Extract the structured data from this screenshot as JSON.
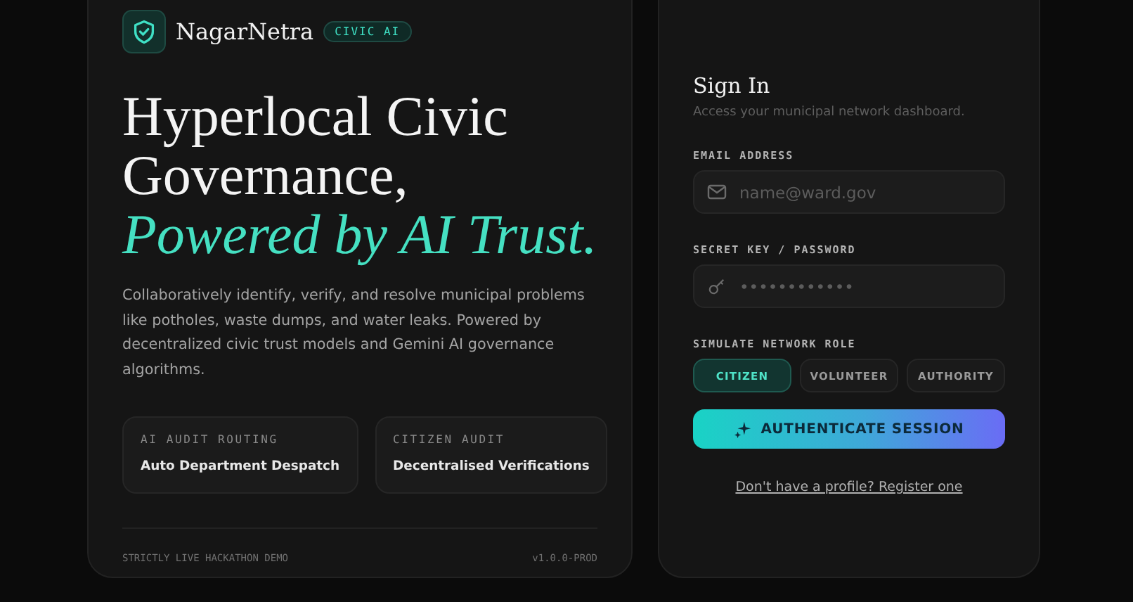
{
  "brand": {
    "name": "NagarNetra",
    "badge": "CIVIC AI"
  },
  "hero": {
    "title_lines": [
      "Hyperlocal Civic",
      "Governance,"
    ],
    "accent_line": "Powered by AI Trust.",
    "description": "Collaboratively identify, verify, and resolve municipal problems like potholes, waste dumps, and water leaks. Powered by decentralized civic trust models and Gemini AI governance algorithms."
  },
  "features": [
    {
      "label": "AI AUDIT ROUTING",
      "title": "Auto Department Despatch"
    },
    {
      "label": "CITIZEN AUDIT",
      "title": "Decentralised Verifications"
    }
  ],
  "footer": {
    "left": "STRICTLY LIVE HACKATHON DEMO",
    "right": "v1.0.0-PROD"
  },
  "signin": {
    "title": "Sign In",
    "subtitle": "Access your municipal network dashboard.",
    "fields": [
      {
        "kind": "email",
        "label": "EMAIL ADDRESS",
        "placeholder": "name@ward.gov"
      },
      {
        "kind": "password",
        "label": "SECRET KEY / PASSWORD",
        "placeholder": "••••••••••••"
      }
    ],
    "role_label": "SIMULATE NETWORK ROLE",
    "roles": [
      {
        "label": "CITIZEN",
        "selected": true
      },
      {
        "label": "VOLUNTEER",
        "selected": false
      },
      {
        "label": "AUTHORITY",
        "selected": false
      }
    ],
    "submit": "AUTHENTICATE SESSION",
    "register_link": "Don't have a profile? Register one"
  }
}
